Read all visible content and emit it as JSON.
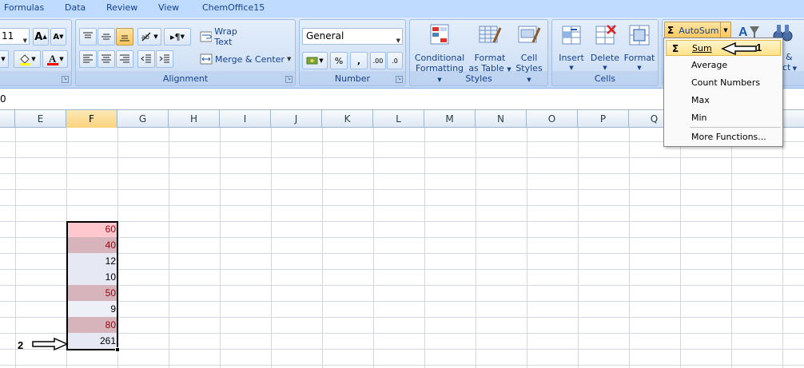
{
  "tabs": [
    "Formulas",
    "Data",
    "Review",
    "View",
    "ChemOffice15"
  ],
  "font_group": {
    "size_value": "11",
    "grow_label": "A",
    "shrink_label": "A"
  },
  "alignment_group": {
    "label": "Alignment",
    "wrap_text": "Wrap Text",
    "merge_center": "Merge & Center"
  },
  "number_group": {
    "label": "Number",
    "format_value": "General",
    "percent": "%",
    "comma": ",",
    "inc_decimal": ".00",
    "dec_decimal": ".0"
  },
  "styles_group": {
    "label": "Styles",
    "conditional": [
      "Conditional",
      "Formatting"
    ],
    "format_table": [
      "Format",
      "as Table"
    ],
    "cell_styles": [
      "Cell",
      "Styles"
    ]
  },
  "cells_group": {
    "label": "Cells",
    "insert": "Insert",
    "delete": "Delete",
    "format": "Format"
  },
  "editing_group": {
    "autosum": "AutoSum",
    "sort_partial": "&",
    "find_partial": "ct"
  },
  "formula_bar": {
    "value": "0"
  },
  "columns": [
    "E",
    "F",
    "G",
    "H",
    "I",
    "J",
    "K",
    "L",
    "M",
    "N",
    "O",
    "P",
    "Q"
  ],
  "selected_column": "F",
  "cells": [
    {
      "value": "60",
      "fill": "#ffc7ce",
      "color": "#9c0006"
    },
    {
      "value": "40",
      "fill": "#d7b4bb",
      "color": "#9c0006"
    },
    {
      "value": "12",
      "fill": "#e6e9f4",
      "color": "#000000"
    },
    {
      "value": "10",
      "fill": "#e6e9f4",
      "color": "#000000"
    },
    {
      "value": "50",
      "fill": "#d7b4bb",
      "color": "#9c0006"
    },
    {
      "value": "9",
      "fill": "#eef0f8",
      "color": "#000000"
    },
    {
      "value": "80",
      "fill": "#d7b4bb",
      "color": "#9c0006"
    },
    {
      "value": "261",
      "fill": "#e6e9f4",
      "color": "#000000"
    }
  ],
  "autosum_menu": {
    "items": [
      "Sum",
      "Average",
      "Count Numbers",
      "Max",
      "Min",
      "More Functions..."
    ]
  },
  "callouts": {
    "one": "1",
    "two": "2"
  },
  "colors": {
    "ribbon_bg": "#dbe8f9",
    "highlight": "#ffe38a",
    "bad_fill": "#ffc7ce",
    "bad_text": "#9c0006"
  }
}
